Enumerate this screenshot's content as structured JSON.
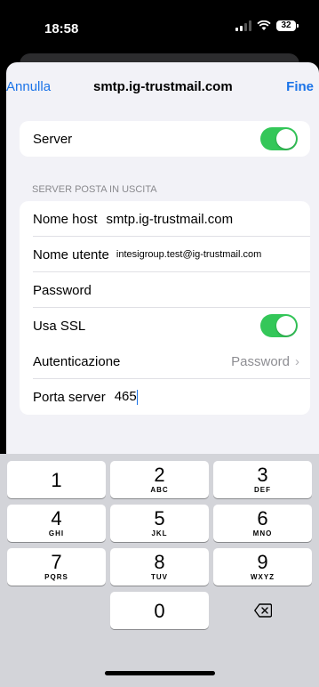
{
  "status_bar": {
    "time": "18:58",
    "battery": "32"
  },
  "nav": {
    "cancel": "Annulla",
    "title": "smtp.ig-trustmail.com",
    "done": "Fine"
  },
  "server_row": {
    "label": "Server",
    "enabled": true
  },
  "section_header": "SERVER POSTA IN USCITA",
  "fields": {
    "hostname_label": "Nome host",
    "hostname_value": "smtp.ig-trustmail.com",
    "username_label": "Nome utente",
    "username_value": "intesigroup.test@ig-trustmail.com",
    "password_label": "Password",
    "ssl_label": "Usa SSL",
    "ssl_enabled": true,
    "auth_label": "Autenticazione",
    "auth_value": "Password",
    "port_label": "Porta server",
    "port_value": "465"
  },
  "keyboard": {
    "keys": [
      {
        "num": "1",
        "letters": ""
      },
      {
        "num": "2",
        "letters": "ABC"
      },
      {
        "num": "3",
        "letters": "DEF"
      },
      {
        "num": "4",
        "letters": "GHI"
      },
      {
        "num": "5",
        "letters": "JKL"
      },
      {
        "num": "6",
        "letters": "MNO"
      },
      {
        "num": "7",
        "letters": "PQRS"
      },
      {
        "num": "8",
        "letters": "TUV"
      },
      {
        "num": "9",
        "letters": "WXYZ"
      },
      {
        "num": "0",
        "letters": ""
      }
    ],
    "delete_icon": "delete-backspace-icon"
  }
}
